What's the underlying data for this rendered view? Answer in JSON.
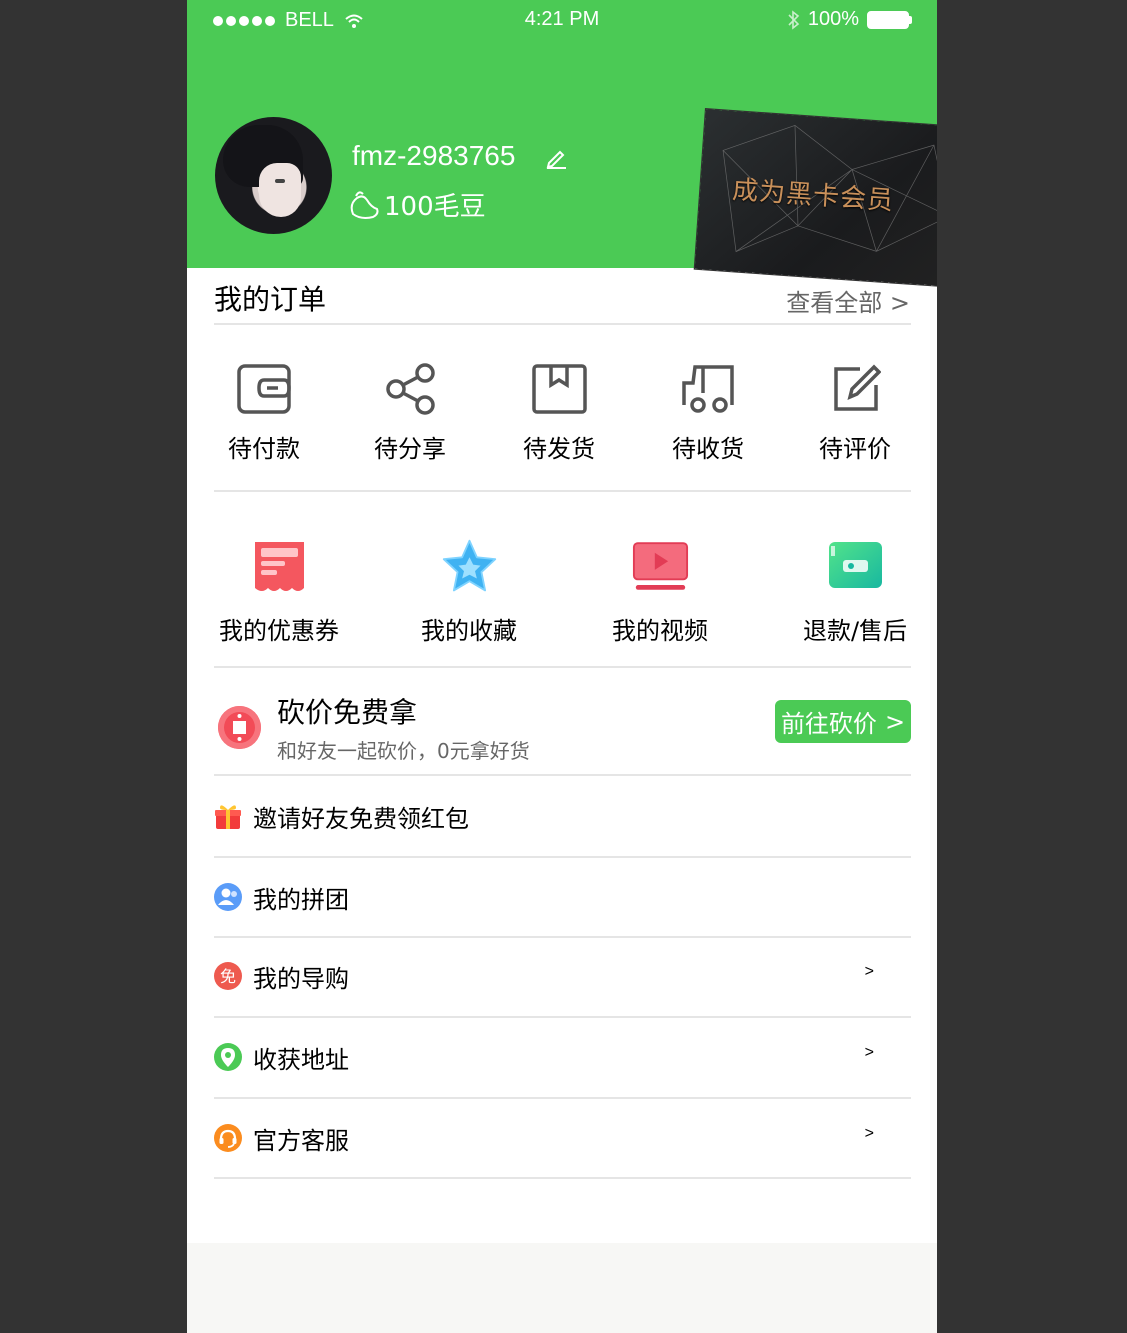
{
  "status_bar": {
    "carrier": "BELL",
    "time": "4:21 PM",
    "battery": "100%"
  },
  "profile": {
    "username": "fmz-2983765",
    "points": "100毛豆"
  },
  "vip_card": {
    "text": "成为黑卡会员"
  },
  "orders": {
    "title": "我的订单",
    "view_all": "查看全部  >",
    "items": [
      {
        "label": "待付款",
        "icon": "wallet-icon"
      },
      {
        "label": "待分享",
        "icon": "share-icon"
      },
      {
        "label": "待发货",
        "icon": "package-icon"
      },
      {
        "label": "待收货",
        "icon": "truck-icon"
      },
      {
        "label": "待评价",
        "icon": "edit-icon"
      }
    ]
  },
  "services": [
    {
      "label": "我的优惠券",
      "icon": "coupon-icon",
      "color": "#f4575f"
    },
    {
      "label": "我的收藏",
      "icon": "star-icon",
      "color": "#3fb2f2"
    },
    {
      "label": "我的视频",
      "icon": "video-icon",
      "color": "#e84a5f"
    },
    {
      "label": "退款/售后",
      "icon": "refund-icon",
      "color": "#2bc79a"
    }
  ],
  "bargain": {
    "title": "砍价免费拿",
    "subtitle": "和好友一起砍价，0元拿好货",
    "button": "前往砍价",
    "button_arrow": ">"
  },
  "menu": [
    {
      "label": "邀请好友免费领红包",
      "icon": "gift-icon",
      "arrow": ""
    },
    {
      "label": "我的拼团",
      "icon": "group-icon",
      "arrow": ""
    },
    {
      "label": "我的导购",
      "icon": "guide-icon",
      "arrow": ">"
    },
    {
      "label": "收获地址",
      "icon": "location-icon",
      "arrow": ">"
    },
    {
      "label": "官方客服",
      "icon": "service-icon",
      "arrow": ">"
    }
  ],
  "colors": {
    "brand_green": "#4bca55",
    "text_black": "#000000",
    "subtitle": "rgba(0,0,0,0.8)"
  }
}
